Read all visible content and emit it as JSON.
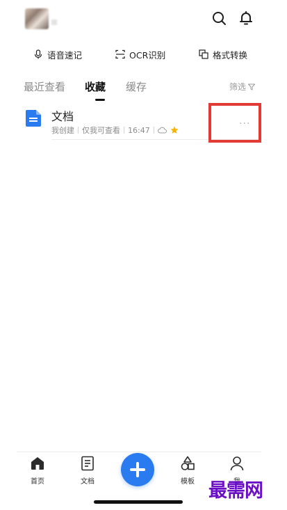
{
  "header": {
    "avatar_icon": "user-avatar-blurred",
    "search_icon": "search-icon",
    "bell_icon": "bell-icon"
  },
  "tools": {
    "voice_label": "语音速记",
    "ocr_label": "OCR识别",
    "convert_label": "格式转换"
  },
  "tabs": {
    "recent": "最近查看",
    "favorites": "收藏",
    "cache": "缓存",
    "filter": "筛选"
  },
  "doc": {
    "title": "文档",
    "creator": "我创建",
    "visibility": "仅我可查看",
    "time": "16:47",
    "more": "···",
    "icon_color": "#2a7bf0",
    "star_color": "#f5b400"
  },
  "nav": {
    "home": "首页",
    "docs": "文档",
    "templates": "模板",
    "me": "我"
  },
  "watermark": "最需网",
  "colors": {
    "accent": "#2a7bf0",
    "highlight_border": "#e23a35",
    "watermark": "#6a0fc6"
  }
}
